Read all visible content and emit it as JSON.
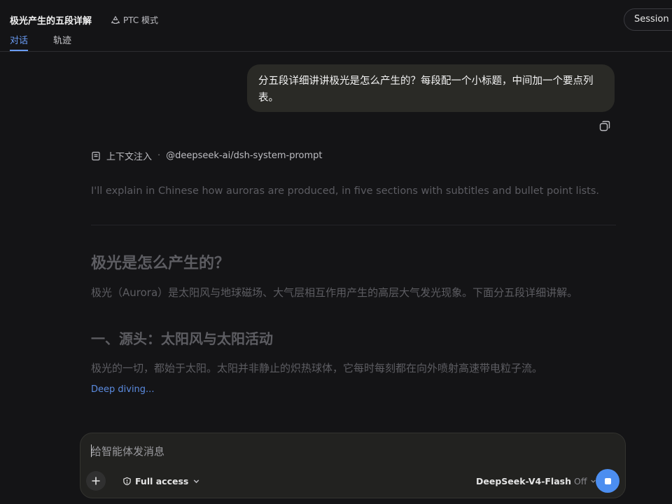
{
  "header": {
    "title": "极光产生的五段详解",
    "mode_label": "PTC 模式",
    "session_button": "Session lo",
    "tabs": [
      {
        "label": "对话",
        "active": true
      },
      {
        "label": "轨迹",
        "active": false
      }
    ]
  },
  "conversation": {
    "user_message": "分五段详细讲讲极光是怎么产生的？每段配一个小标题，中间加一个要点列表。",
    "context": {
      "label": "上下文注入",
      "separator": "·",
      "source": "@deepseek-ai/dsh-system-prompt"
    },
    "thinking": "I'll explain in Chinese how auroras are produced, in five sections with subtitles and bullet point lists.",
    "answer": {
      "heading": "极光是怎么产生的？",
      "intro": "极光（Aurora）是太阳风与地球磁场、大气层相互作用产生的高层大气发光现象。下面分五段详细讲解。",
      "section1_heading": "一、源头：太阳风与太阳活动",
      "section1_text": "极光的一切，都始于太阳。太阳并非静止的炽热球体，它每时每刻都在向外喷射高速带电粒子流。",
      "status": "Deep diving..."
    }
  },
  "composer": {
    "placeholder": "给智能体发消息",
    "access_label": "Full access",
    "model_name": "DeepSeek-V4-Flash",
    "model_suffix": "Off"
  },
  "colors": {
    "accent": "#4c8ef0",
    "tab_active": "#6a9cf5",
    "background": "#141416"
  }
}
